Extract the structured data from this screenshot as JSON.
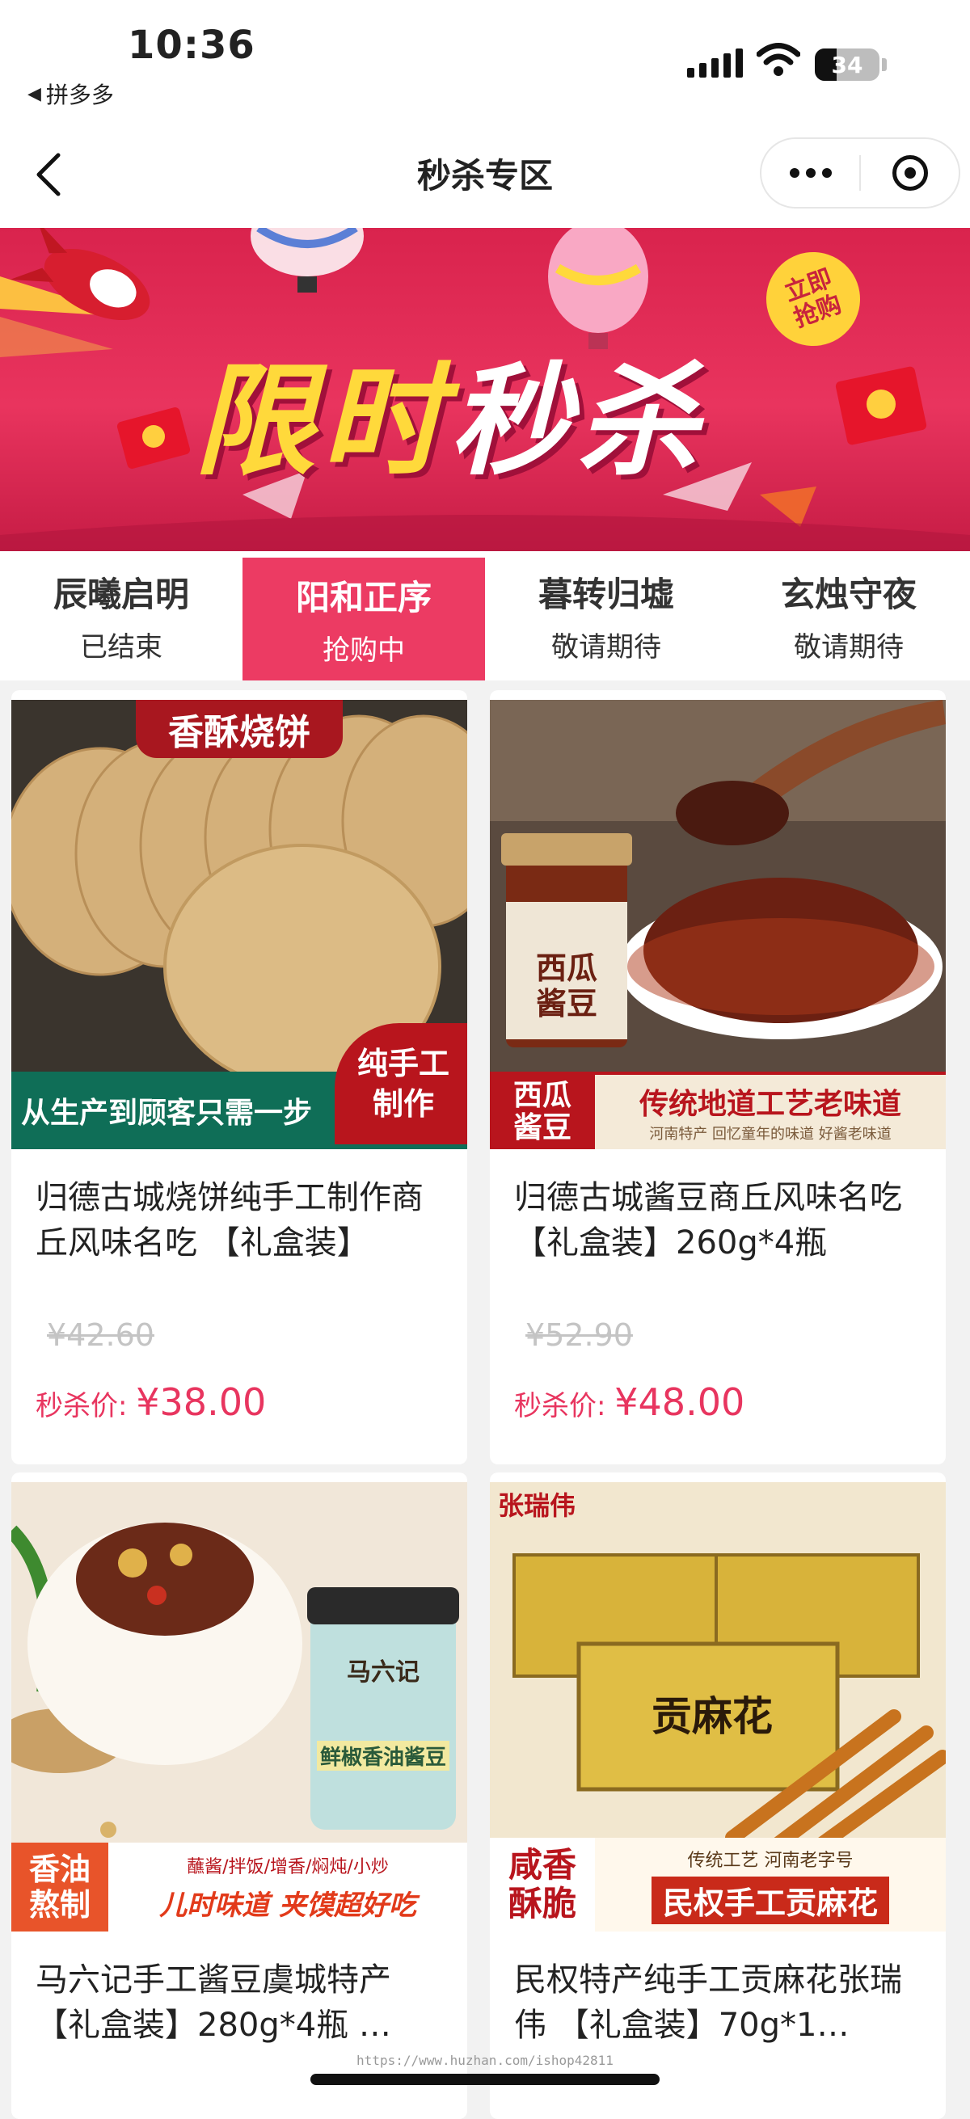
{
  "status": {
    "time": "10:36",
    "back_app": "拼多多",
    "battery": "34",
    "battery_level": 0.34
  },
  "nav": {
    "title": "秒杀专区"
  },
  "banner": {
    "title_part1": "限时",
    "title_part2": "秒杀",
    "badge_line1": "立即",
    "badge_line2": "抢购"
  },
  "sessions": [
    {
      "name": "辰曦启明",
      "state": "已结束",
      "active": false
    },
    {
      "name": "阳和正序",
      "state": "抢购中",
      "active": true
    },
    {
      "name": "暮转归墟",
      "state": "敬请期待",
      "active": false
    },
    {
      "name": "玄烛守夜",
      "state": "敬请期待",
      "active": false
    }
  ],
  "products": [
    {
      "title": "归德古城烧饼纯手工制作商丘风味名吃 【礼盒装】",
      "original_price": "¥42.60",
      "sale_label": "秒杀价: ",
      "sale_price": "¥38.00",
      "image": {
        "top_label": "香酥烧饼",
        "bottom_text": "从生产到顾客只需一步",
        "badge": "纯手工\n制作"
      }
    },
    {
      "title": "归德古城酱豆商丘风味名吃 【礼盒装】260g*4瓶",
      "original_price": "¥52.90",
      "sale_label": "秒杀价: ",
      "sale_price": "¥48.00",
      "image": {
        "jar_label": "西瓜酱豆",
        "bottom_left": "西瓜\n酱豆",
        "bottom_text": "传统地道工艺老味道",
        "sub_text": "河南特产   回忆童年的味道   好酱老味道"
      }
    },
    {
      "title": "马六记手工酱豆虞城特产 【礼盒装】280g*4瓶 …",
      "original_price": "",
      "sale_label": "",
      "sale_price": "",
      "image": {
        "jar_brand": "马六记",
        "jar_label": "鲜椒香油酱豆",
        "bottom_left": "香油\n熬制",
        "tags": "蘸酱/拌饭/增香/焖炖/小炒",
        "bottom_text": "儿时味道 夹馍超好吃"
      }
    },
    {
      "title": "民权特产纯手工贡麻花张瑞伟 【礼盒装】70g*1…",
      "original_price": "",
      "sale_label": "",
      "sale_price": "",
      "image": {
        "top_left": "张瑞伟",
        "box_label": "贡麻花",
        "bottom_left": "咸香\n酥脆",
        "tags": "传统工艺  河南老字号",
        "bottom_text": "民权手工贡麻花"
      }
    }
  ],
  "watermark": "https://www.huzhan.com/ishop42811"
}
